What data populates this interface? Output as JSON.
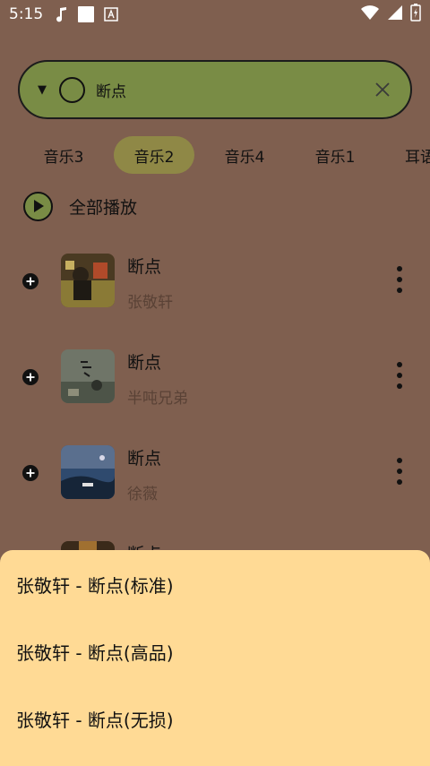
{
  "status_bar": {
    "time": "5:15"
  },
  "search": {
    "query": "断点"
  },
  "tabs": [
    "音乐3",
    "音乐2",
    "音乐4",
    "音乐1",
    "耳语"
  ],
  "play_all_label": "全部播放",
  "songs": [
    {
      "title": "断点",
      "artist": "张敬轩"
    },
    {
      "title": "断点",
      "artist": "半吨兄弟"
    },
    {
      "title": "断点",
      "artist": "徐薇"
    },
    {
      "title": "断点",
      "artist": ""
    }
  ],
  "sheet_options": [
    "张敬轩 - 断点(标准)",
    "张敬轩 - 断点(高品)",
    "张敬轩 - 断点(无损)"
  ],
  "colors": {
    "background": "#7f5f4f",
    "search_fill": "#798c45",
    "tab_active": "#8f8846",
    "sheet": "#ffda95"
  }
}
